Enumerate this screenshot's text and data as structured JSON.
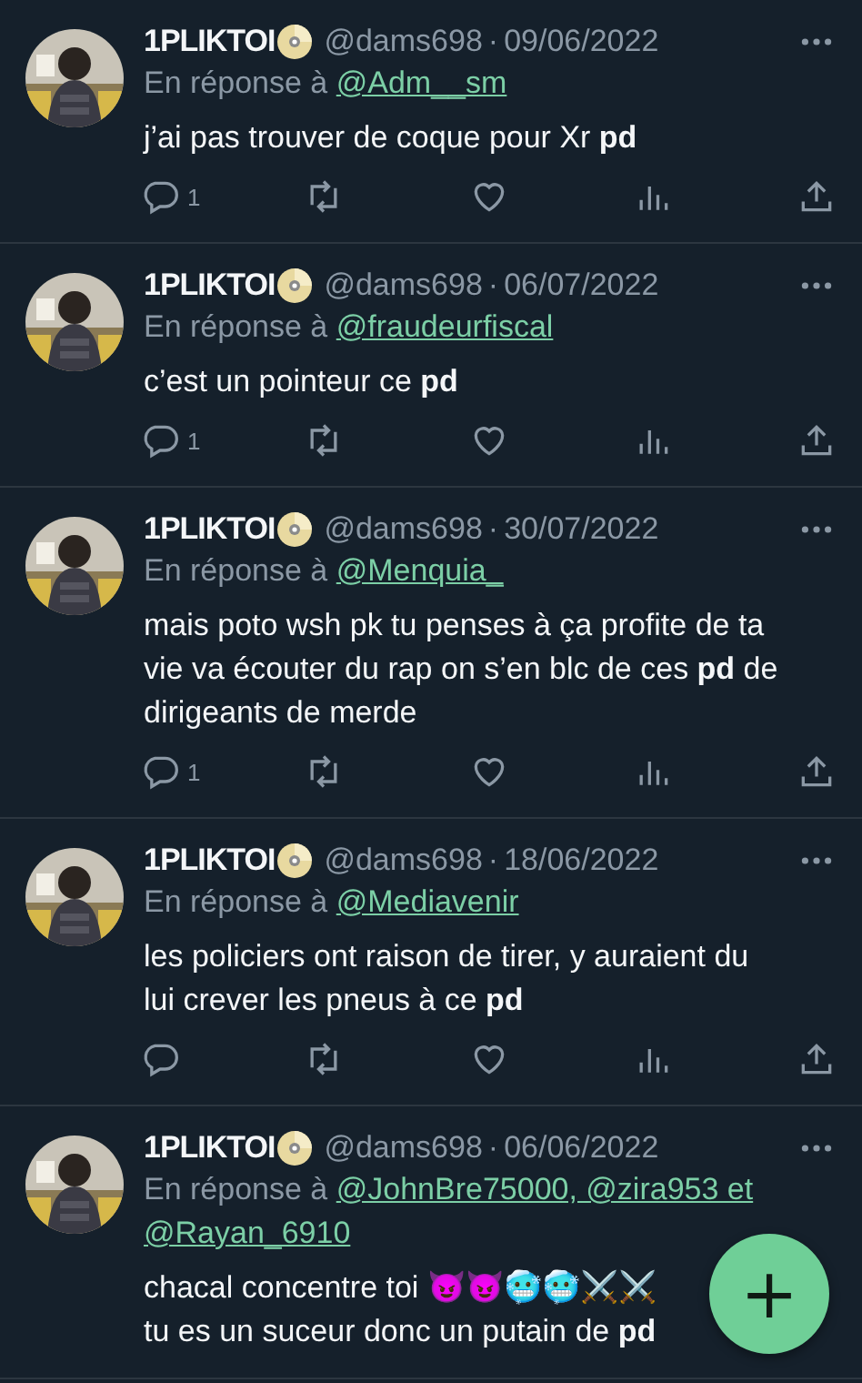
{
  "tweets": [
    {
      "name": "1PLIKTOI",
      "handle": "@dams698",
      "dot": "·",
      "date": "09/06/2022",
      "reply_label": "En réponse à",
      "reply_to": "@Adm__sm",
      "text": "j’ai pas trouver de coque pour Xr **pd**",
      "replies": "1"
    },
    {
      "name": "1PLIKTOI",
      "handle": "@dams698",
      "dot": "·",
      "date": "06/07/2022",
      "reply_label": "En réponse à",
      "reply_to": "@fraudeurfiscal",
      "text": "c’est un pointeur ce **pd**",
      "replies": "1"
    },
    {
      "name": "1PLIKTOI",
      "handle": "@dams698",
      "dot": "·",
      "date": "30/07/2022",
      "reply_label": "En réponse à",
      "reply_to": "@Menquia_",
      "text": "mais poto wsh pk tu penses à ça profite de ta vie va écouter du rap on s’en blc de ces **pd** de dirigeants de merde",
      "replies": "1"
    },
    {
      "name": "1PLIKTOI",
      "handle": "@dams698",
      "dot": "·",
      "date": "18/06/2022",
      "reply_label": "En réponse à",
      "reply_to": "@Mediavenir",
      "text": "les policiers ont raison de tirer, y auraient du lui crever les pneus à ce **pd**"
    },
    {
      "name": "1PLIKTOI",
      "handle": "@dams698",
      "dot": "·",
      "date": "06/06/2022",
      "reply_label": "En réponse à",
      "reply_to": "@JohnBre75000, @zira953 et",
      "reply_to_more": "@Rayan_6910",
      "actions_cut_off": true,
      "text": "chacal concentre toi 😈😈🥶🥶⚔️⚔️\ntu es un suceur donc un putain de **pd**"
    }
  ],
  "fab": {
    "label": "+"
  }
}
